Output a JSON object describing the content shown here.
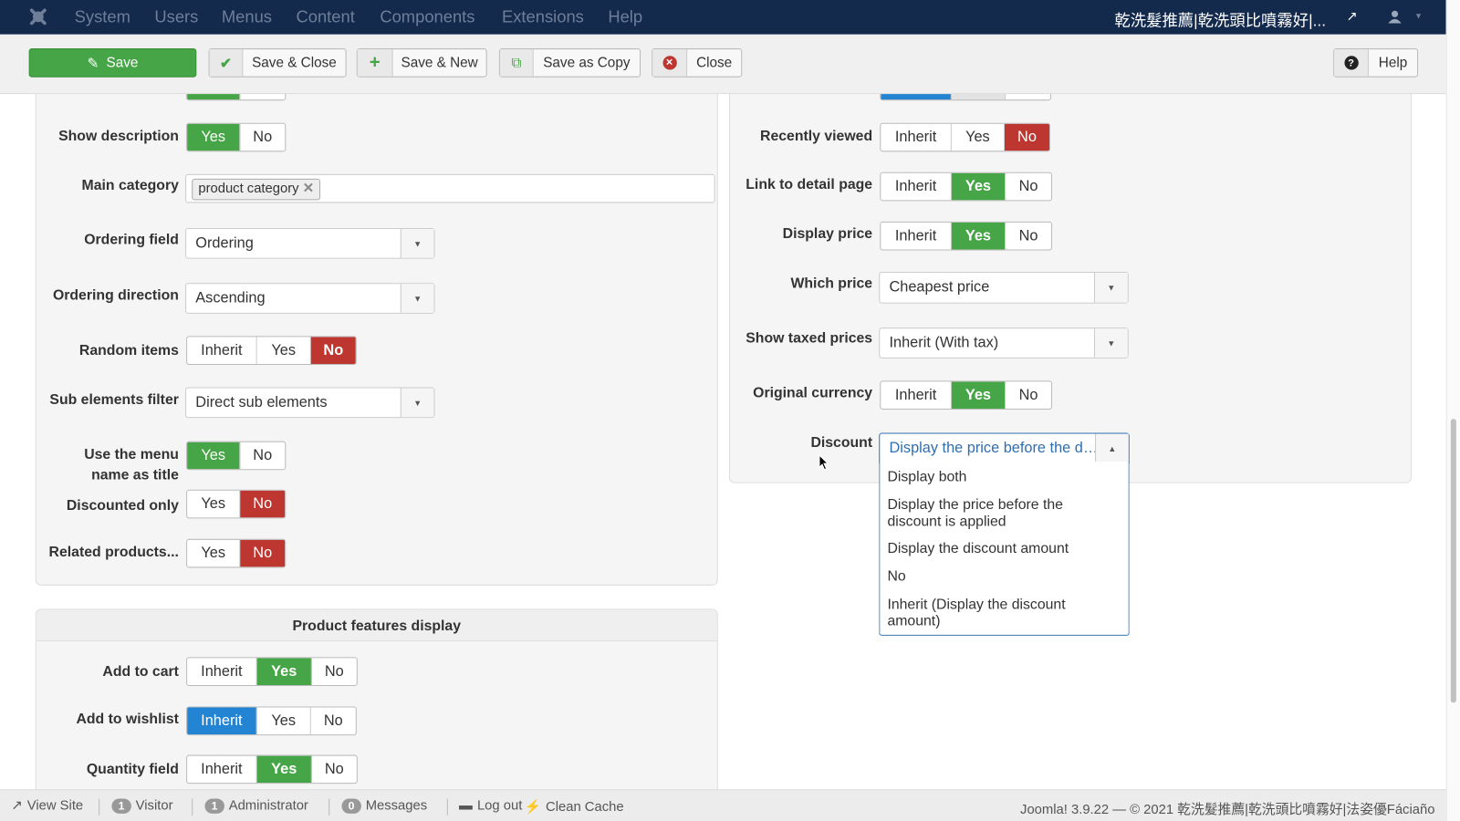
{
  "navbar": {
    "menu": [
      "System",
      "Users",
      "Menus",
      "Content",
      "Components",
      "Extensions",
      "Help"
    ],
    "site_title": "乾洗髮推薦|乾洗頭比噴霧好|..."
  },
  "toolbar": {
    "save": "Save",
    "save_close": "Save & Close",
    "save_new": "Save & New",
    "save_copy": "Save as Copy",
    "close": "Close",
    "help": "Help"
  },
  "left": {
    "show_description": {
      "label": "Show description",
      "options": [
        "Yes",
        "No"
      ],
      "selected": "Yes"
    },
    "main_category": {
      "label": "Main category",
      "chip": "product category"
    },
    "ordering_field": {
      "label": "Ordering field",
      "value": "Ordering"
    },
    "ordering_direction": {
      "label": "Ordering direction",
      "value": "Ascending"
    },
    "random_items": {
      "label": "Random items",
      "options": [
        "Inherit",
        "Yes",
        "No"
      ],
      "selected": "No"
    },
    "sub_elements_filter": {
      "label": "Sub elements filter",
      "value": "Direct sub elements"
    },
    "use_menu_name": {
      "label_line1": "Use the menu",
      "label_line2": "name as title",
      "options": [
        "Yes",
        "No"
      ],
      "selected": "Yes"
    },
    "discounted_only": {
      "label": "Discounted only",
      "options": [
        "Yes",
        "No"
      ],
      "selected": "No"
    },
    "related_products": {
      "label": "Related products...",
      "options": [
        "Yes",
        "No"
      ],
      "selected": "No"
    }
  },
  "features": {
    "title": "Product features display",
    "add_to_cart": {
      "label": "Add to cart",
      "options": [
        "Inherit",
        "Yes",
        "No"
      ],
      "selected": "Yes"
    },
    "add_to_wishlist": {
      "label": "Add to wishlist",
      "options": [
        "Inherit",
        "Yes",
        "No"
      ],
      "selected": "Inherit"
    },
    "quantity_field": {
      "label": "Quantity field",
      "options": [
        "Inherit",
        "Yes",
        "No"
      ],
      "selected": "Yes"
    }
  },
  "right": {
    "recently_viewed": {
      "label": "Recently viewed",
      "options": [
        "Inherit",
        "Yes",
        "No"
      ],
      "selected": "No"
    },
    "link_detail": {
      "label": "Link to detail page",
      "options": [
        "Inherit",
        "Yes",
        "No"
      ],
      "selected": "Yes"
    },
    "display_price": {
      "label": "Display price",
      "options": [
        "Inherit",
        "Yes",
        "No"
      ],
      "selected": "Yes"
    },
    "which_price": {
      "label": "Which price",
      "value": "Cheapest price"
    },
    "show_taxed": {
      "label": "Show taxed prices",
      "value": "Inherit (With tax)"
    },
    "original_currency": {
      "label": "Original currency",
      "options": [
        "Inherit",
        "Yes",
        "No"
      ],
      "selected": "Yes"
    },
    "discount": {
      "label": "Discount",
      "value": "Display the price before the d…",
      "options": [
        "Display both",
        "Display the price before the discount is applied",
        "Display the discount amount",
        "No",
        "Inherit (Display the discount amount)"
      ]
    }
  },
  "footer": {
    "view_site": "View Site",
    "visitors": "1",
    "visitor_label": "Visitor",
    "admins": "1",
    "admin_label": "Administrator",
    "messages": "0",
    "messages_label": "Messages",
    "logout": "Log out",
    "clean_cache": "Clean Cache",
    "copyright": "Joomla! 3.9.22  —  © 2021 乾洗髮推薦|乾洗頭比噴霧好|法姿優Fáciaño"
  },
  "colors": {
    "navbar": "#132a4d",
    "yes": "#46a546",
    "no": "#bd362f",
    "inherit": "#2384d3"
  }
}
